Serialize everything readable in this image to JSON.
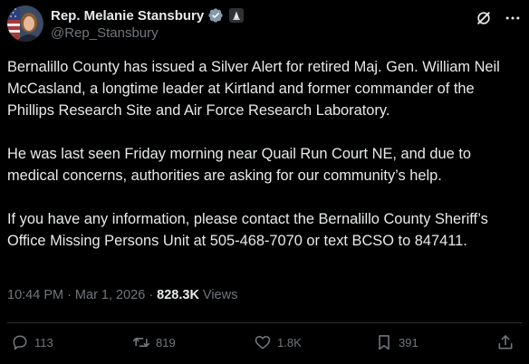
{
  "author": {
    "display_name": "Rep. Melanie Stansbury",
    "handle": "@Rep_Stansbury"
  },
  "post": {
    "paragraphs": [
      "Bernalillo County has issued a Silver Alert for retired Maj. Gen. William Neil McCasland, a longtime leader at Kirtland and former commander of the Phillips Research Site and Air Force Research Laboratory.",
      "He was last seen Friday morning near Quail Run Court NE, and due to medical concerns, authorities are asking for our community’s help.",
      "If you have any information, please contact the Bernalillo County Sheriff’s Office Missing Persons Unit at 505-468-7070 or text BCSO to 847411."
    ],
    "time": "10:44 PM",
    "date": "Mar 1, 2026",
    "views_count": "828.3K",
    "views_label": "Views"
  },
  "actions": {
    "replies": "113",
    "reposts": "819",
    "likes": "1.8K",
    "bookmarks": "391"
  },
  "icons": {
    "reply": "reply-icon",
    "repost": "repost-icon",
    "like": "heart-icon",
    "bookmark": "bookmark-icon",
    "share": "share-icon",
    "verified": "verified-badge-icon",
    "government": "government-badge-icon",
    "grok": "grok-icon",
    "more": "more-icon"
  },
  "colors": {
    "background": "#000000",
    "text": "#e7e9ea",
    "muted": "#71767b",
    "verified_badge": "#829aab"
  }
}
